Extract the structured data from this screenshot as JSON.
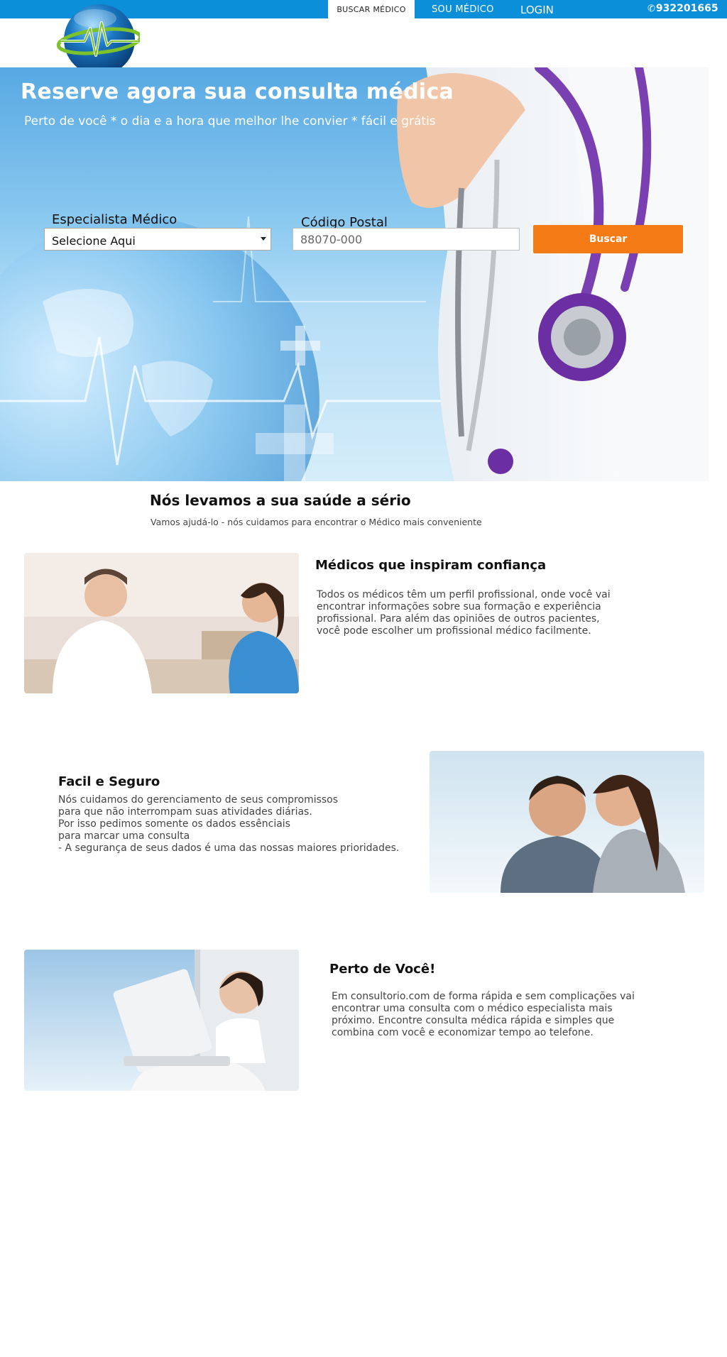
{
  "nav": {
    "items": [
      {
        "label": "BUSCAR MÉDICO"
      },
      {
        "label": "SOU MÉDICO"
      },
      {
        "label": "LOGIN"
      }
    ],
    "phone": "932201665",
    "phone_icon": "phone-icon"
  },
  "colors": {
    "topbar": "#0b8fd8",
    "accent_button": "#f47b16",
    "logo_globe": "#1a78c2",
    "logo_pulse": "#7cc22a"
  },
  "hero": {
    "title": "Reserve agora sua consulta médica",
    "subtitle": "Perto de você  * o dia e a hora que melhor lhe convier * fácil e grátis",
    "search": {
      "specialist_label": "Especialista Médico",
      "specialist_selected": "Selecione Aqui",
      "postal_label": "Código Postal",
      "postal_placeholder": "88070-000",
      "button_label": "Buscar"
    }
  },
  "intro": {
    "title": "Nós levamos a sua saúde a sério",
    "subtitle": "Vamos ajudá-lo - nós cuidamos para encontrar o Médico mais conveniente"
  },
  "features": [
    {
      "title": "Médicos que inspiram confiança",
      "lines": [
        "Todos os médicos têm um perfil profissional, onde você vai",
        "encontrar informações sobre sua formação e experiência",
        "profissional. Para além das opiniões de outros pacientes,",
        "você pode escolher um profissional médico facilmente."
      ]
    },
    {
      "title": "Facil e Seguro",
      "lines": [
        "Nós cuidamos do gerenciamento de seus compromissos",
        "para que não interrompam suas atividades diárias.",
        "Por isso pedimos somente os dados essênciais",
        "para marcar uma consulta",
        "- A segurança de seus dados é uma das nossas maiores prioridades."
      ]
    },
    {
      "title": "Perto de Você!",
      "lines": [
        "Em consultorio.com de forma rápida e sem complicações vai",
        "encontrar uma consulta com o médico especialista mais",
        "próximo. Encontre consulta médica rápida e simples que",
        "combina com você e economizar tempo ao telefone."
      ]
    }
  ]
}
